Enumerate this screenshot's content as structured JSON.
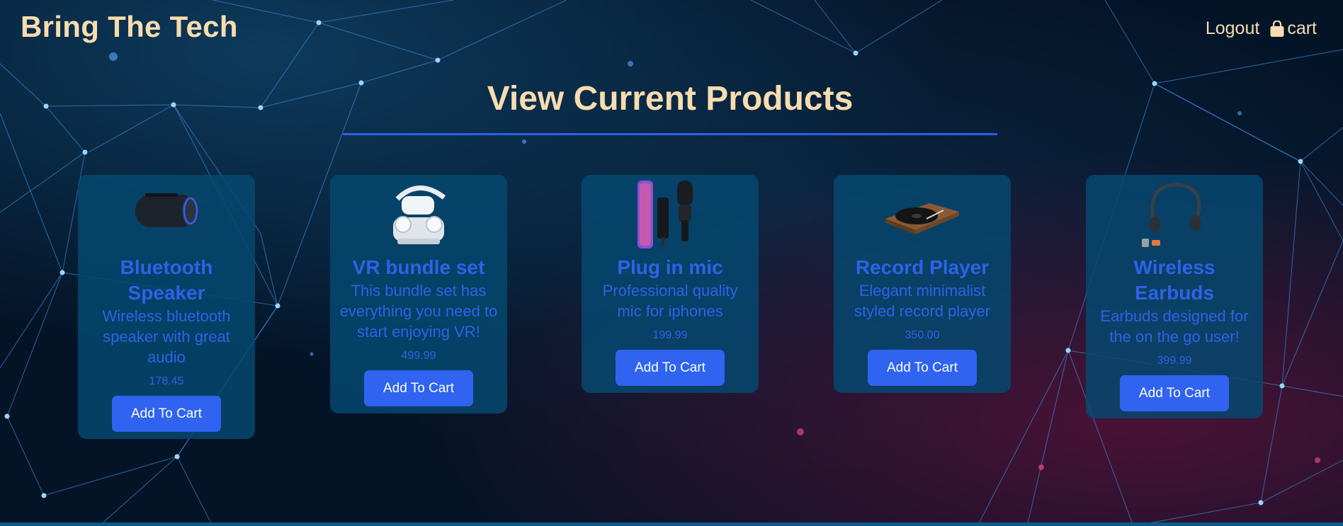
{
  "header": {
    "brand": "Bring The Tech",
    "logout_label": "Logout",
    "cart_label": "cart"
  },
  "main": {
    "title": "View Current Products"
  },
  "products": [
    {
      "name": "Bluetooth Speaker",
      "description": "Wireless bluetooth speaker with great audio",
      "price": "178.45",
      "button_label": "Add To Cart"
    },
    {
      "name": "VR bundle set",
      "description": "This bundle set has everything you need to start enjoying VR!",
      "price": "499.99",
      "button_label": "Add To Cart"
    },
    {
      "name": "Plug in mic",
      "description": "Professional quality mic for iphones",
      "price": "199.99",
      "button_label": "Add To Cart"
    },
    {
      "name": "Record Player",
      "description": "Elegant minimalist styled record player",
      "price": "350.00",
      "button_label": "Add To Cart"
    },
    {
      "name": "Wireless Earbuds",
      "description": "Earbuds designed for the on the go user!",
      "price": "399.99",
      "button_label": "Add To Cart"
    }
  ],
  "colors": {
    "brand_text": "#f7dcae",
    "accent": "#2f63f0",
    "card_bg": "#064870",
    "page_bg": "#041326"
  },
  "icons": {
    "cart": "shopping-bag-icon"
  }
}
